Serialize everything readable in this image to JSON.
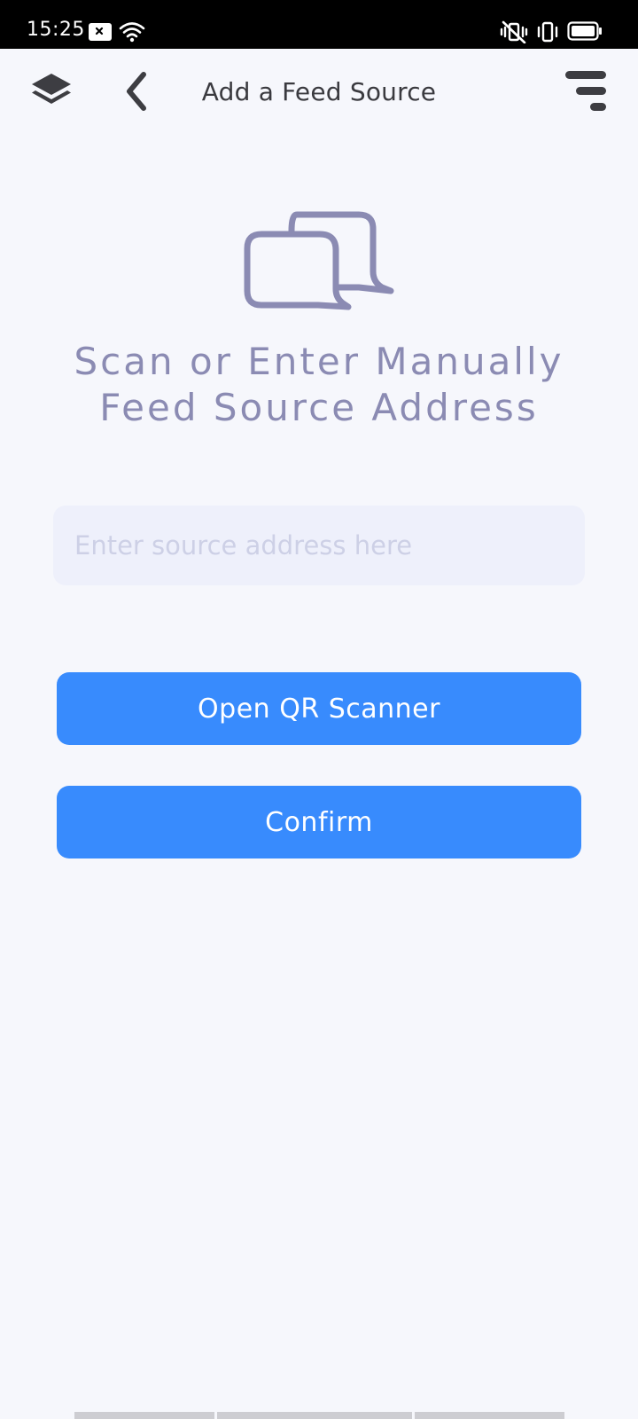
{
  "status_bar": {
    "time": "15:25",
    "icons": [
      "notification-icon",
      "wifi-icon",
      "mute-vibrate-icon",
      "vibrate-icon",
      "battery-icon"
    ]
  },
  "app_bar": {
    "title": "Add a Feed Source",
    "icons": [
      "layers-icon",
      "back-arrow-icon",
      "filter-menu-icon"
    ]
  },
  "hero": {
    "icon": "chat-bubbles-icon",
    "heading_line1": "Scan or Enter Manually",
    "heading_line2": "Feed Source Address"
  },
  "address_input": {
    "value": "",
    "placeholder": "Enter source address here"
  },
  "actions": {
    "scanner_label": "Open QR Scanner",
    "confirm_label": "Confirm"
  },
  "colors": {
    "accent": "#388bfd",
    "heading": "#8b8bb3",
    "background": "#f6f7fc",
    "input_background": "#eef0fb"
  }
}
